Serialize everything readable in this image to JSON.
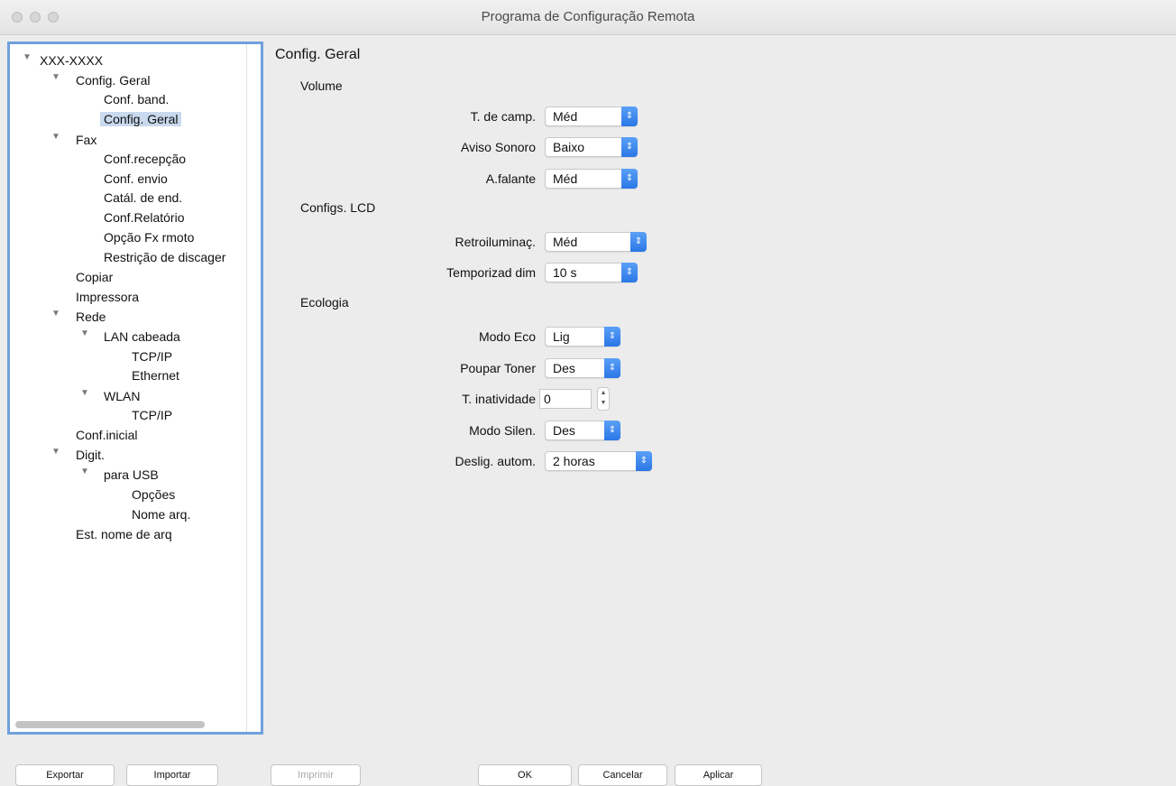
{
  "window": {
    "title": "Programa de Configuração Remota"
  },
  "tree": {
    "items": [
      {
        "label": "XXX-XXXX",
        "expanded": true
      },
      {
        "label": "Config. Geral",
        "expanded": true
      },
      {
        "label": "Conf. band."
      },
      {
        "label": "Config. Geral",
        "selected": true
      },
      {
        "label": "Fax",
        "expanded": true
      },
      {
        "label": "Conf.recepção"
      },
      {
        "label": "Conf. envio"
      },
      {
        "label": "Catál. de end."
      },
      {
        "label": "Conf.Relatório"
      },
      {
        "label": "Opção Fx rmoto"
      },
      {
        "label": "Restrição de discager"
      },
      {
        "label": "Copiar"
      },
      {
        "label": "Impressora"
      },
      {
        "label": "Rede",
        "expanded": true
      },
      {
        "label": "LAN cabeada",
        "expanded": true
      },
      {
        "label": "TCP/IP"
      },
      {
        "label": "Ethernet"
      },
      {
        "label": "WLAN",
        "expanded": true
      },
      {
        "label": "TCP/IP"
      },
      {
        "label": "Conf.inicial"
      },
      {
        "label": "Digit.",
        "expanded": true
      },
      {
        "label": "para USB",
        "expanded": true
      },
      {
        "label": "Opções"
      },
      {
        "label": "Nome arq."
      },
      {
        "label": "Est. nome de arq"
      }
    ]
  },
  "panel": {
    "heading": "Config. Geral",
    "volume": {
      "title": "Volume",
      "ring_label": "T. de camp.",
      "ring_value": "Méd",
      "beeper_label": "Aviso Sonoro",
      "beeper_value": "Baixo",
      "speaker_label": "A.falante",
      "speaker_value": "Méd"
    },
    "lcd": {
      "title": "Configs. LCD",
      "backlight_label": "Retroiluminaç.",
      "backlight_value": "Méd",
      "dim_timer_label": "Temporizad dim",
      "dim_timer_value": "10 s"
    },
    "eco": {
      "title": "Ecologia",
      "eco_mode_label": "Modo Eco",
      "eco_mode_value": "Lig",
      "toner_save_label": "Poupar Toner",
      "toner_save_value": "Des",
      "sleep_time_label": "T. inatividade",
      "sleep_time_value": "0",
      "quiet_mode_label": "Modo Silen.",
      "quiet_mode_value": "Des",
      "auto_off_label": "Deslig. autom.",
      "auto_off_value": "2 horas"
    }
  },
  "buttons": {
    "export": "Exportar",
    "import": "Importar",
    "print": "Imprimir",
    "ok": "OK",
    "cancel": "Cancelar",
    "apply": "Aplicar"
  },
  "colors": {
    "accent": "#2b77e6",
    "selection": "#c9d9ee",
    "tree_border": "#6fa0dc"
  }
}
